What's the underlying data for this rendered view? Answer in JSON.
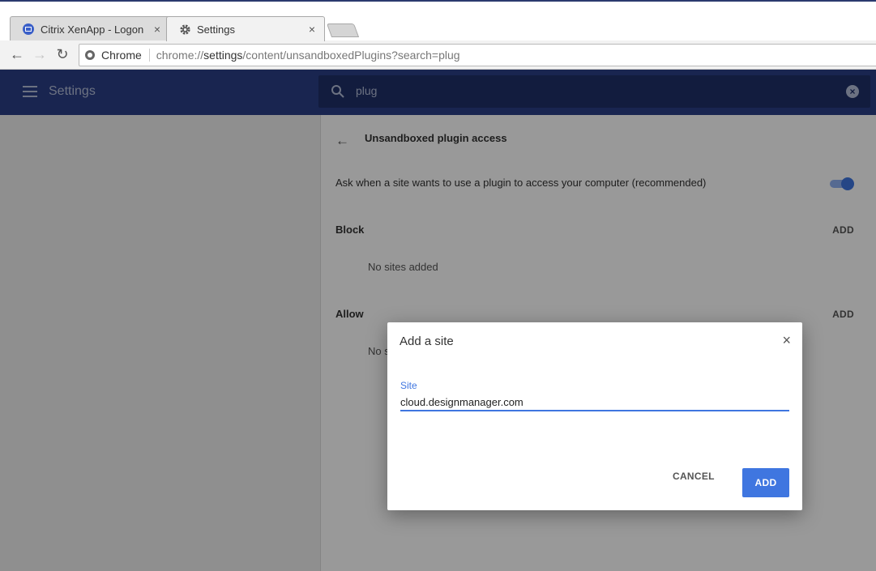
{
  "tabs": [
    {
      "label": "Citrix XenApp - Logon",
      "close": "×"
    },
    {
      "label": "Settings",
      "close": "×"
    }
  ],
  "toolbar": {
    "back": "←",
    "forward": "→",
    "reload": "↻",
    "origin_chip": "Chrome",
    "url_scheme": "chrome://",
    "url_host": "settings",
    "url_rest": "/content/unsandboxedPlugins?search=plug"
  },
  "header": {
    "title": "Settings",
    "search_value": "plug",
    "clear": "×"
  },
  "page": {
    "back": "←",
    "title": "Unsandboxed plugin access",
    "ask_text": "Ask when a site wants to use a plugin to access your computer (recommended)",
    "toggle_on": true,
    "block": {
      "label": "Block",
      "add": "ADD",
      "empty": "No sites added"
    },
    "allow": {
      "label": "Allow",
      "add": "ADD",
      "empty": "No sites added"
    }
  },
  "dialog": {
    "title": "Add a site",
    "close": "×",
    "field_label": "Site",
    "field_value": "cloud.designmanager.com",
    "cancel": "CANCEL",
    "add": "ADD"
  },
  "colors": {
    "header_bg": "#2b3f86",
    "search_bg": "#1f2f68",
    "accent": "#3f76e0"
  }
}
